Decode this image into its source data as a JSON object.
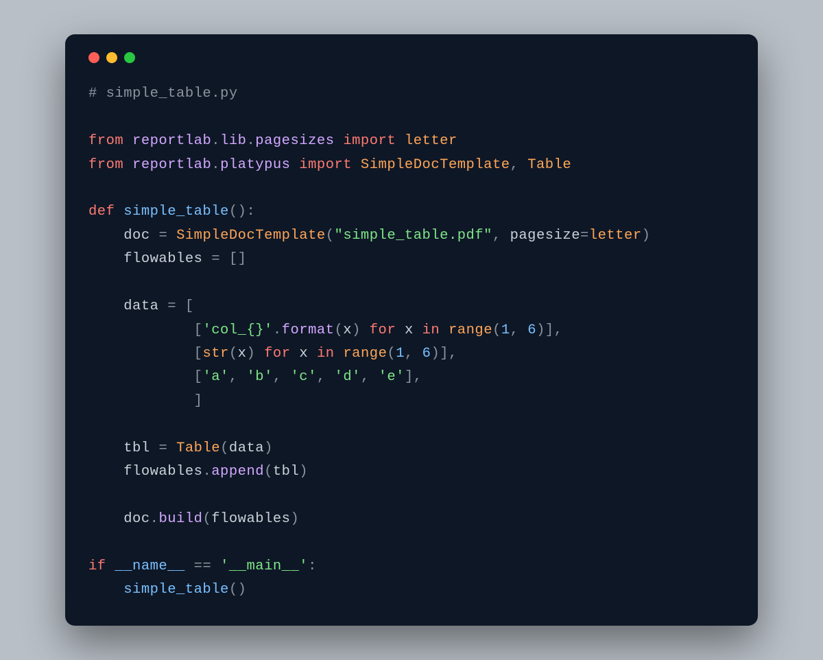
{
  "window": {
    "traffic": {
      "close": "#ff5f57",
      "min": "#febc2e",
      "max": "#28c840"
    }
  },
  "code": {
    "l1_comment": "# simple_table.py",
    "kw_from": "from",
    "kw_import": "import",
    "kw_def": "def",
    "kw_for": "for",
    "kw_in": "in",
    "kw_if": "if",
    "mod_reportlab": "reportlab",
    "mod_lib": "lib",
    "mod_pagesizes": "pagesizes",
    "mod_platypus": "platypus",
    "meth_format": "format",
    "meth_append": "append",
    "meth_build": "build",
    "id_letter": "letter",
    "id_doc": "doc",
    "id_flowables": "flowables",
    "id_data": "data",
    "id_x": "x",
    "id_tbl": "tbl",
    "id_pagesize": "pagesize",
    "fn_simple_table": "simple_table",
    "fn_name": "__name__",
    "call_SimpleDocTemplate": "SimpleDocTemplate",
    "call_Table": "Table",
    "call_str": "str",
    "call_range": "range",
    "str_pdf": "\"simple_table.pdf\"",
    "str_colfmt": "'col_{}'",
    "str_a": "'a'",
    "str_b": "'b'",
    "str_c": "'c'",
    "str_d": "'d'",
    "str_e": "'e'",
    "str_main": "'__main__'",
    "num_1": "1",
    "num_6": "6",
    "op_dot": ".",
    "op_comma": ",",
    "op_colon": ":",
    "op_eq": "=",
    "op_eqeq": "==",
    "op_lparen": "(",
    "op_rparen": ")",
    "op_lbrack": "[",
    "op_rbrack": "]",
    "sp": " "
  }
}
